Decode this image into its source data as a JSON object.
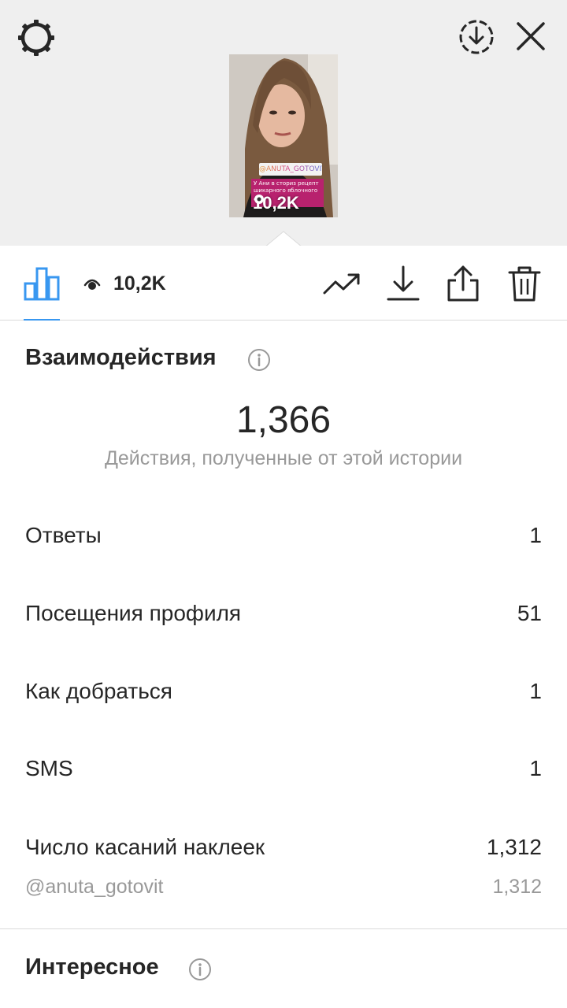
{
  "header": {
    "icons": [
      "gear-icon",
      "save-circle-icon",
      "close-icon"
    ]
  },
  "story_preview": {
    "sticker_tag": "@ANUTA_GOTOVIT",
    "caption": "У Ани в сториз рецепт шикарного яблочного",
    "views": "10,2K"
  },
  "toolbar": {
    "views_count": "10,2K",
    "accent_color": "#3897f0",
    "icons": [
      "bar-chart-icon",
      "eye-icon",
      "trending-icon",
      "download-icon",
      "share-icon",
      "trash-icon"
    ]
  },
  "interactions": {
    "title": "Взаимодействия",
    "total": "1,366",
    "total_label": "Действия, полученные от этой истории",
    "rows": [
      {
        "label": "Ответы",
        "value": "1"
      },
      {
        "label": "Посещения профиля",
        "value": "51"
      },
      {
        "label": "Как добраться",
        "value": "1"
      },
      {
        "label": "SMS",
        "value": "1"
      },
      {
        "label": "Число касаний наклеек",
        "value": "1,312"
      }
    ],
    "sub_row": {
      "label": "@anuta_gotovit",
      "value": "1,312"
    }
  },
  "discovery": {
    "title": "Интересное"
  }
}
